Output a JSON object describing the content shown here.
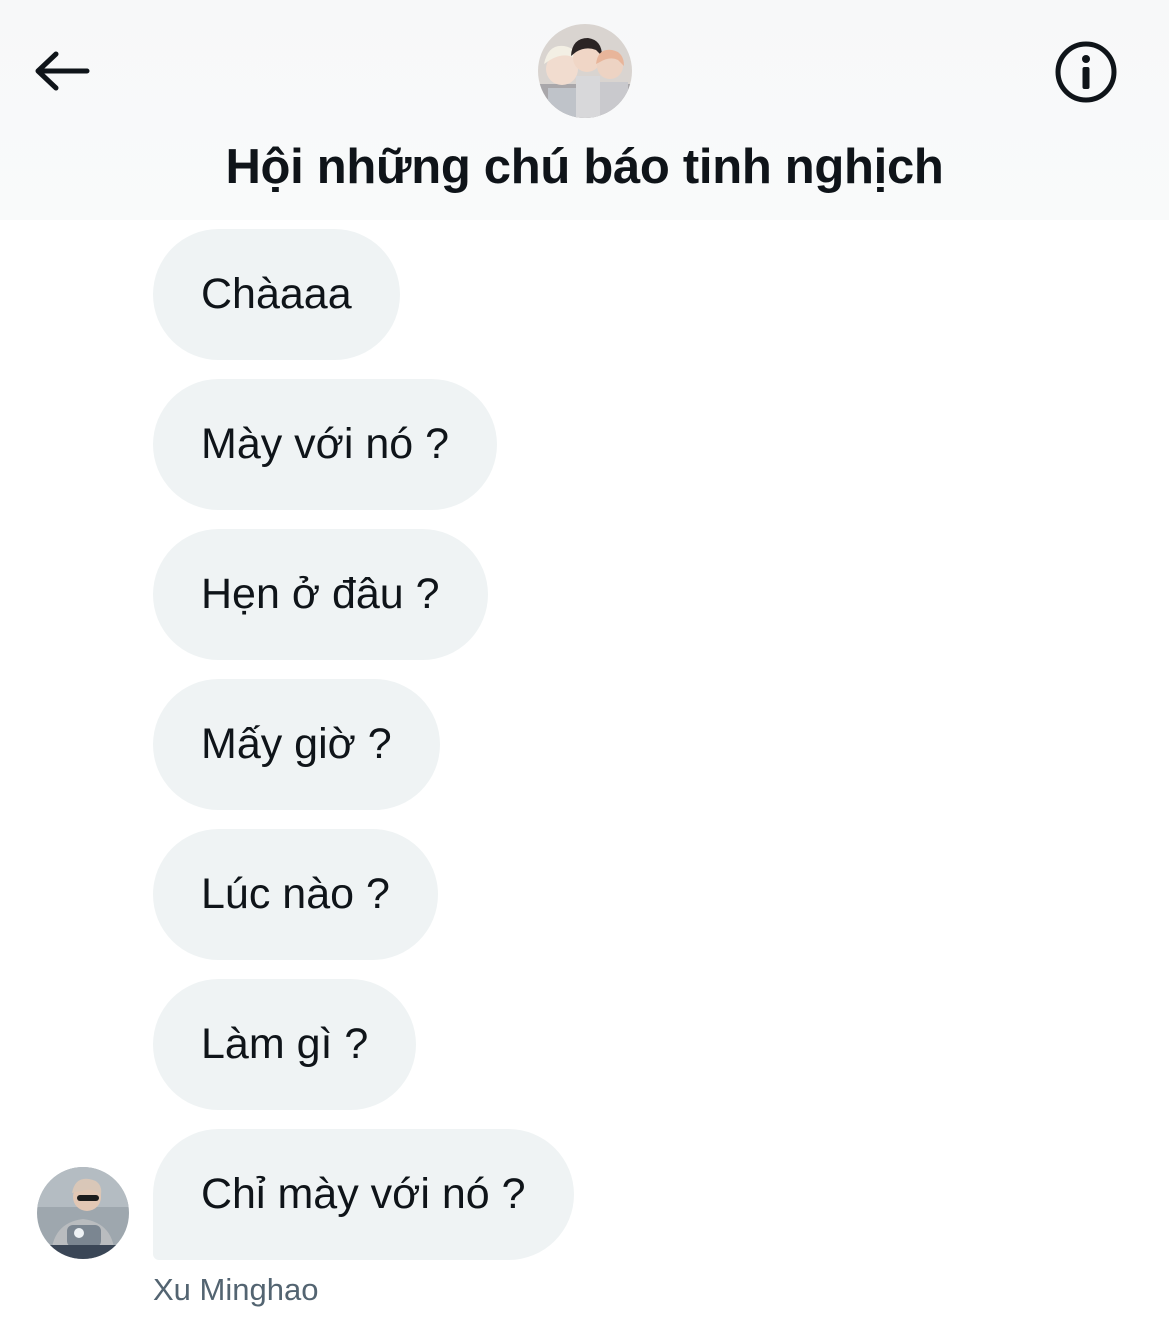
{
  "header": {
    "title": "Hội những chú báo tinh nghịch",
    "back_icon": "arrow-left-icon",
    "info_icon": "info-circle-icon"
  },
  "messages": [
    "Chàaaa",
    "Mày với nó ?",
    "Hẹn ở đâu ?",
    "Mấy giờ ?",
    "Lúc nào ?",
    "Làm gì ?",
    "Chỉ mày với nó ?"
  ],
  "sender": {
    "name": "Xu Minghao"
  },
  "colors": {
    "bubble_bg": "#eff3f4",
    "text": "#0f1419",
    "secondary_text": "#536471",
    "header_bg": "#f7f8f9"
  }
}
